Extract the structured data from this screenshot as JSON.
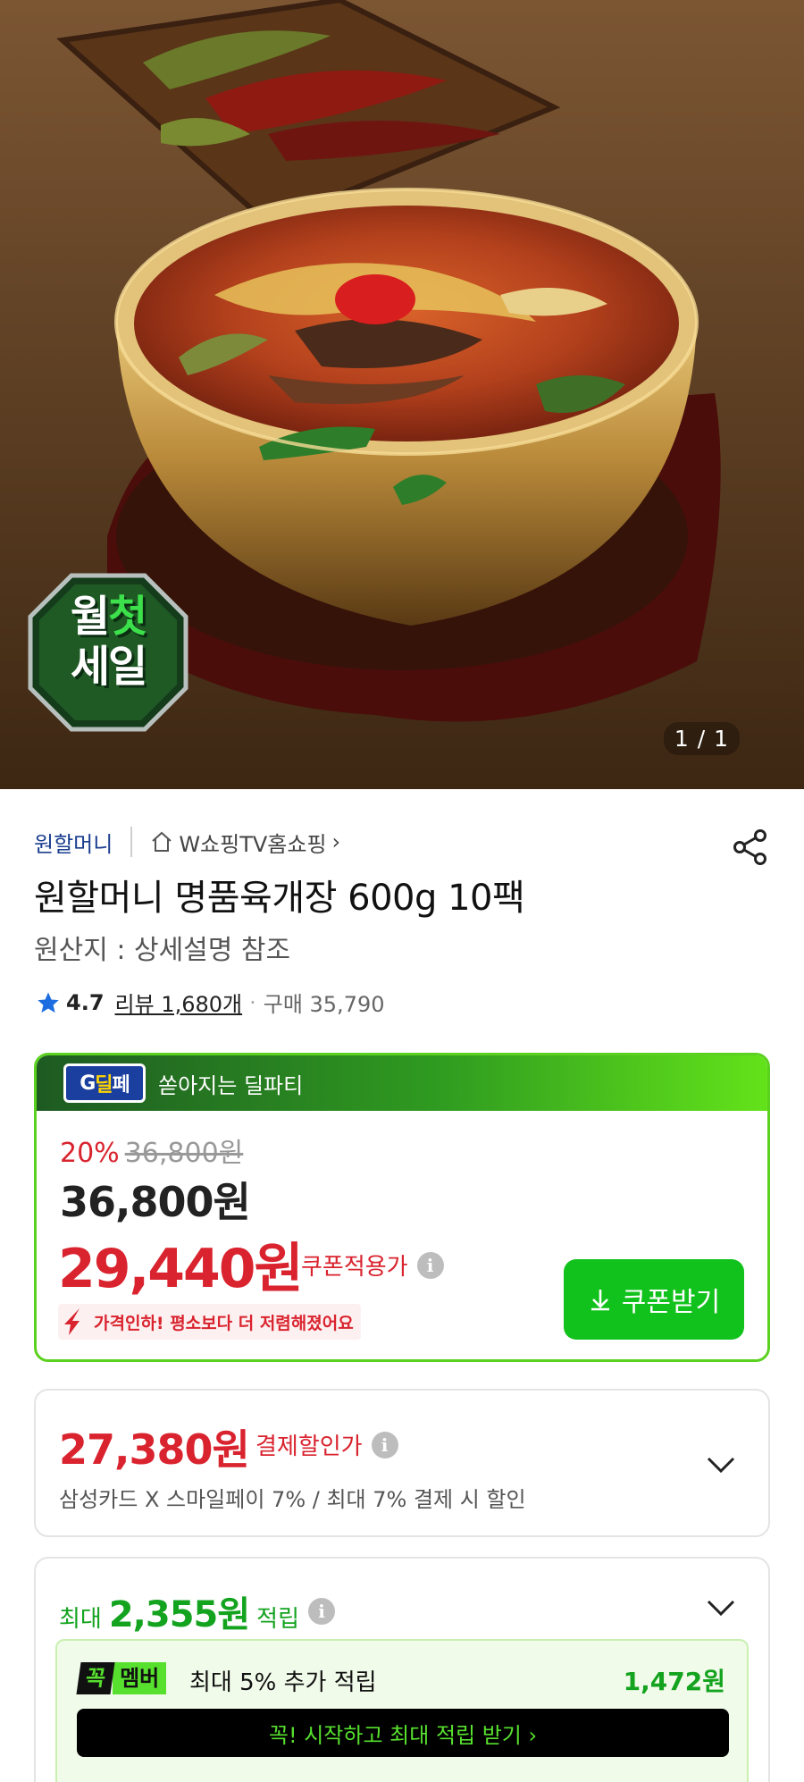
{
  "hero": {
    "page_indicator": "1 / 1",
    "badge": {
      "line1_a": "월",
      "line1_b": "첫",
      "line2": "세일"
    }
  },
  "seller": {
    "name": "원할머니",
    "store": "W쇼핑TV홈쇼핑",
    "store_chevron": "›"
  },
  "product": {
    "title": "원할머니 명품육개장 600g 10팩",
    "origin": "원산지 : 상세설명 참조"
  },
  "rating": {
    "score": "4.7",
    "review": "리뷰 1,680개",
    "dot": "·",
    "purchases": "구매 35,790"
  },
  "deal": {
    "logo_a": "G",
    "logo_b": "딜",
    "logo_c": "페",
    "title": "쏟아지는 딜파티",
    "discount_rate": "20%",
    "original_price": "36,800원",
    "sale_price": "36,800원",
    "coupon_price": "29,440원",
    "coupon_label": "쿠폰적용가",
    "price_drop_note": "가격인하! 평소보다 더 저렴해졌어요",
    "coupon_button": "쿠폰받기"
  },
  "card_discount": {
    "price": "27,380원",
    "label": "결제할인가",
    "description": "삼성카드 X 스마일페이 7%  / 최대 7% 결제 시 할인"
  },
  "reward": {
    "prefix": "최대",
    "amount": "2,355원",
    "suffix": "적립",
    "member_badge_a": "꼭",
    "member_badge_b": "멤버",
    "member_text": "최대 5% 추가 적립",
    "member_amount": "1,472원",
    "member_button": "꼭! 시작하고 최대 적립 받기 ›"
  },
  "info_icon": "i",
  "colors": {
    "brand_green": "#12c21c",
    "price_red": "#d9232e",
    "seller_blue": "#1a3d8f",
    "star_blue": "#1e6de0"
  }
}
